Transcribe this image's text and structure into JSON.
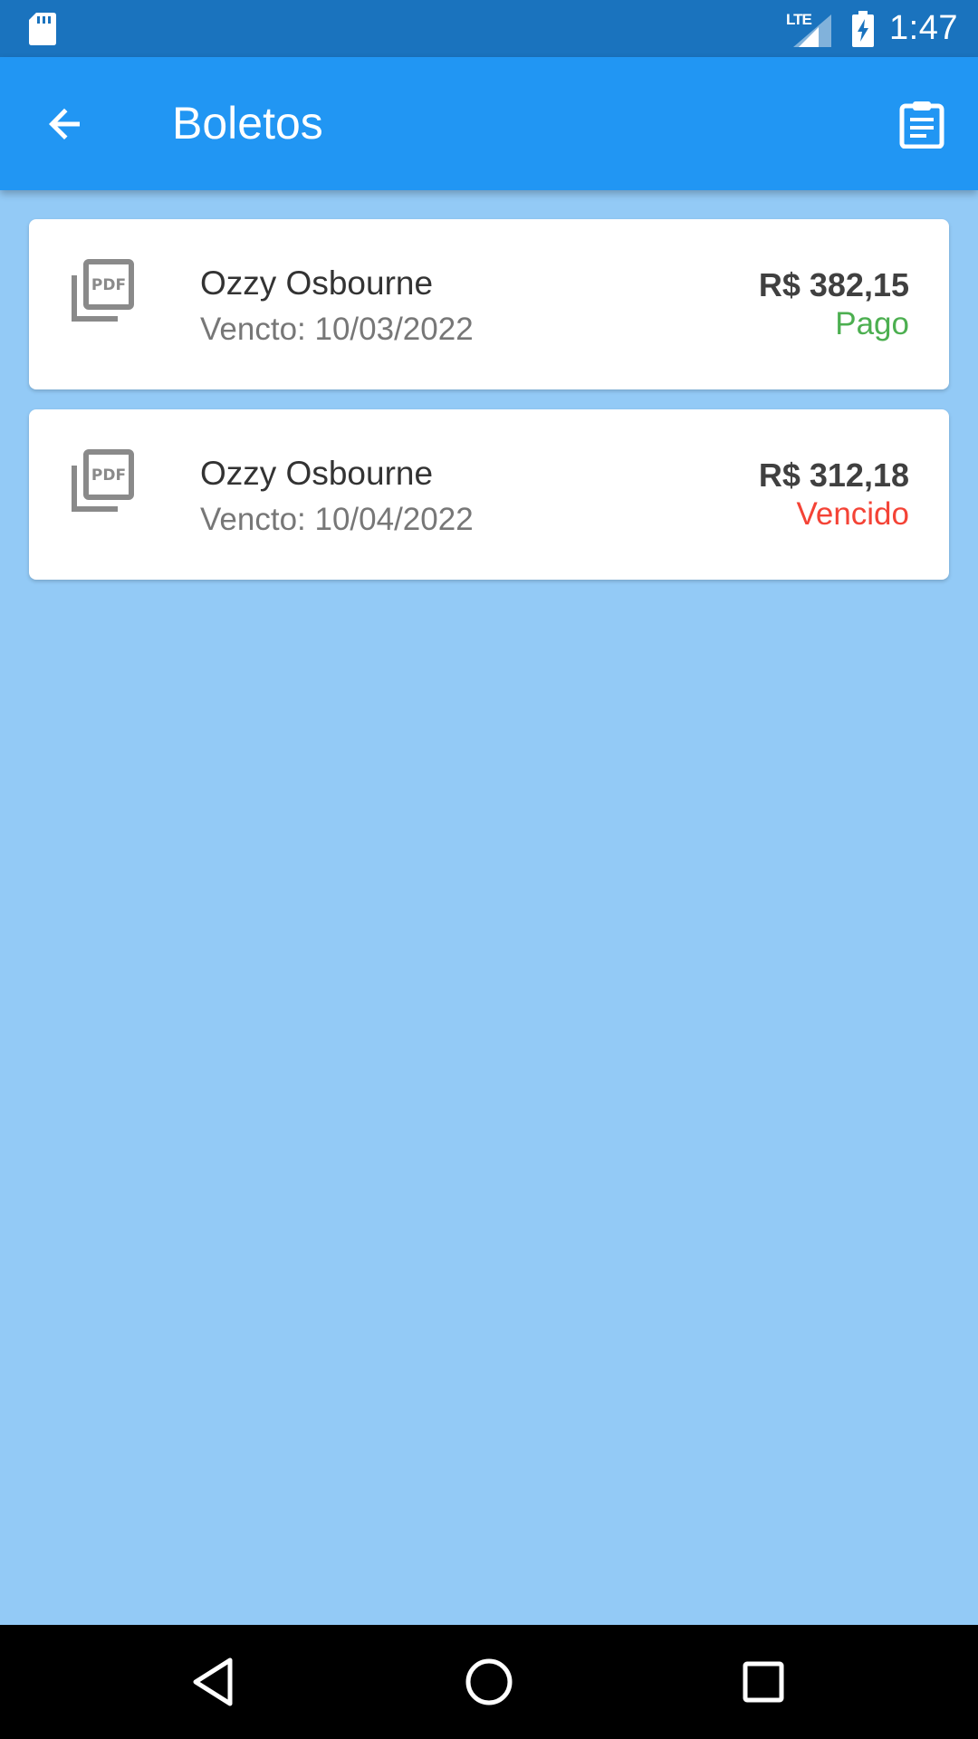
{
  "status_bar": {
    "network": "LTE",
    "time": "1:47"
  },
  "app_bar": {
    "title": "Boletos",
    "back_icon": "arrow-back-icon",
    "action_icon": "clipboard-list-icon"
  },
  "boletos": [
    {
      "icon": "pdf-icon",
      "name": "Ozzy Osbourne",
      "due_date": "Vencto: 10/03/2022",
      "amount": "R$ 382,15",
      "status": "Pago",
      "status_color": "#4CAF50"
    },
    {
      "icon": "pdf-icon",
      "name": "Ozzy Osbourne",
      "due_date": "Vencto: 10/04/2022",
      "amount": "R$ 312,18",
      "status": "Vencido",
      "status_color": "#F44336"
    }
  ],
  "colors": {
    "status_bar": "#1A73BE",
    "app_bar": "#2196F3",
    "background": "#93CAF6",
    "nav_bar": "#000000"
  },
  "nav_bar": {
    "icons": [
      "back-triangle-icon",
      "home-circle-icon",
      "recents-square-icon"
    ]
  }
}
